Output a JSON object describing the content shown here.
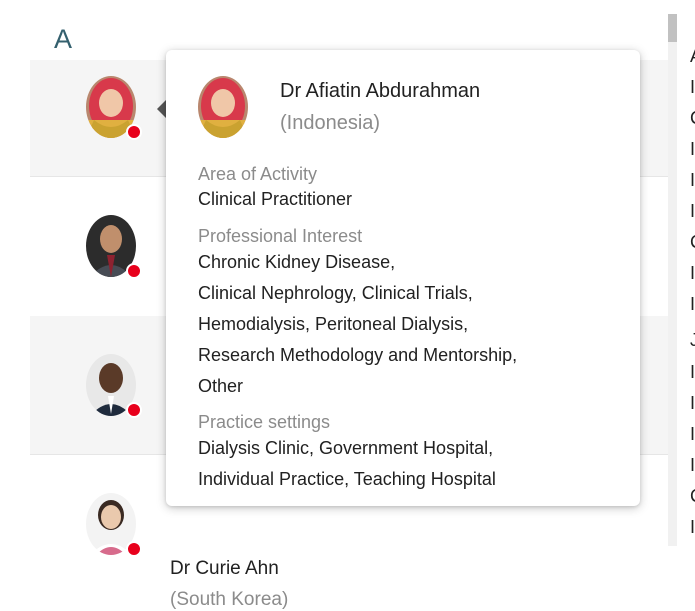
{
  "section_letter": "A",
  "rows": [
    {
      "name": "",
      "country": ""
    },
    {
      "name": "",
      "country": ""
    },
    {
      "name": "",
      "country": ""
    },
    {
      "name": "Dr Curie Ahn",
      "country": "(South Korea)"
    }
  ],
  "popover": {
    "name": "Dr Afiatin Abdurahman",
    "country": "(Indonesia)",
    "area_label": "Area of Activity",
    "area_value": "Clinical Practitioner",
    "interest_label": "Professional Interest",
    "interest_lines": [
      "Chronic Kidney Disease,",
      "Clinical Nephrology, Clinical Trials,",
      "Hemodialysis, Peritoneal Dialysis,",
      "Research Methodology and Mentorship,",
      "Other"
    ],
    "practice_label": "Practice settings",
    "practice_lines": [
      "Dialysis Clinic, Government Hospital,",
      "Individual Practice, Teaching Hospital"
    ]
  },
  "right_column": [
    "A",
    "I",
    "C",
    "I",
    "I",
    "I",
    "C",
    "I",
    "I",
    "J",
    "I",
    "I",
    "I",
    "I",
    "C",
    "I"
  ],
  "colors": {
    "status": "#e8001c",
    "heading": "#34606e",
    "muted": "#8b8b8b",
    "row_shade": "#f5f5f5"
  }
}
